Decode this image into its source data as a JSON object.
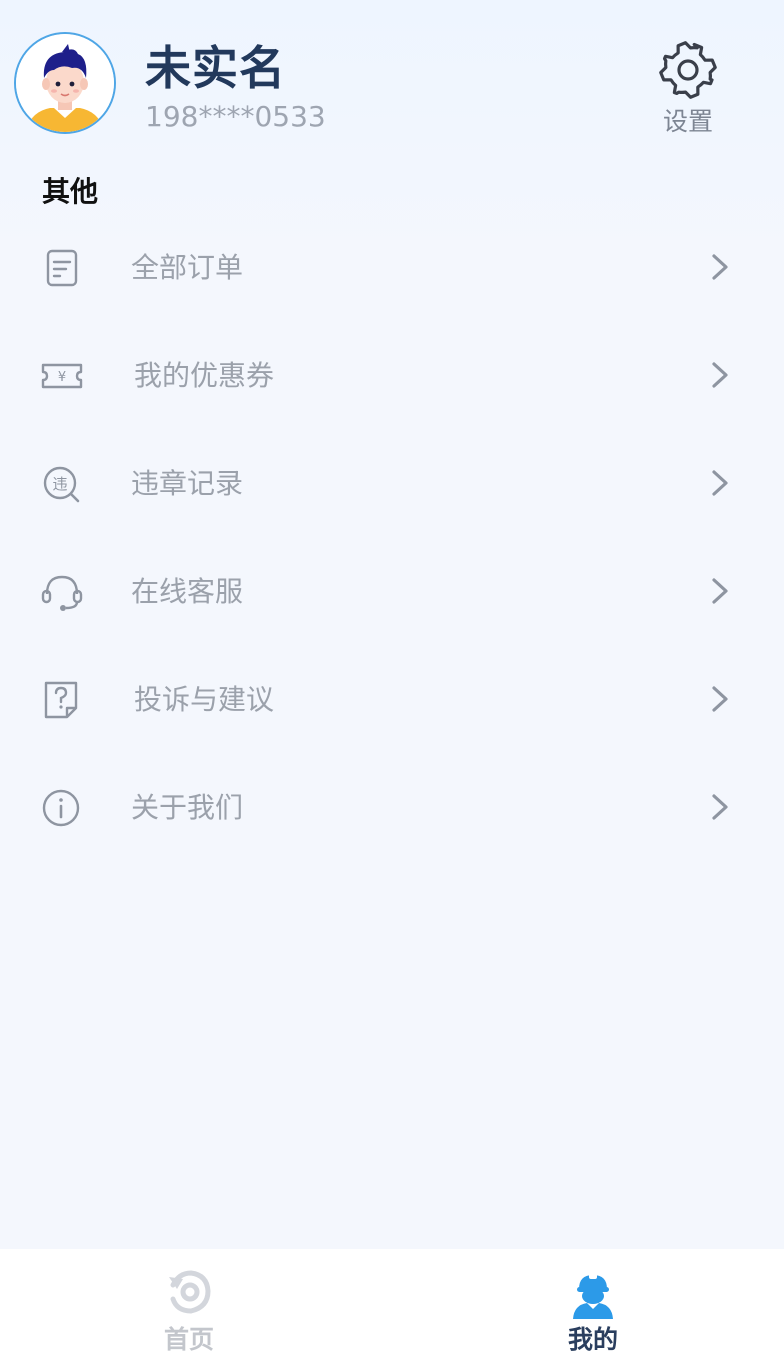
{
  "profile": {
    "name": "未实名",
    "phone": "198****0533"
  },
  "settings": {
    "label": "设置",
    "icon": "gear-icon"
  },
  "section": {
    "title": "其他"
  },
  "menu": {
    "items": [
      {
        "label": "全部订单",
        "icon": "order-list-icon"
      },
      {
        "label": "我的优惠券",
        "icon": "coupon-icon"
      },
      {
        "label": "违章记录",
        "icon": "violation-record-icon"
      },
      {
        "label": "在线客服",
        "icon": "headset-icon"
      },
      {
        "label": "投诉与建议",
        "icon": "feedback-icon"
      },
      {
        "label": "关于我们",
        "icon": "info-icon"
      }
    ]
  },
  "tabs": {
    "home": {
      "label": "首页",
      "icon": "home-icon",
      "active": false
    },
    "mine": {
      "label": "我的",
      "icon": "user-icon",
      "active": true
    }
  },
  "colors": {
    "accent": "#2c9ae8",
    "name_text": "#22395c",
    "menu_text": "#9ba1ab",
    "background": "#f4f7fd"
  }
}
